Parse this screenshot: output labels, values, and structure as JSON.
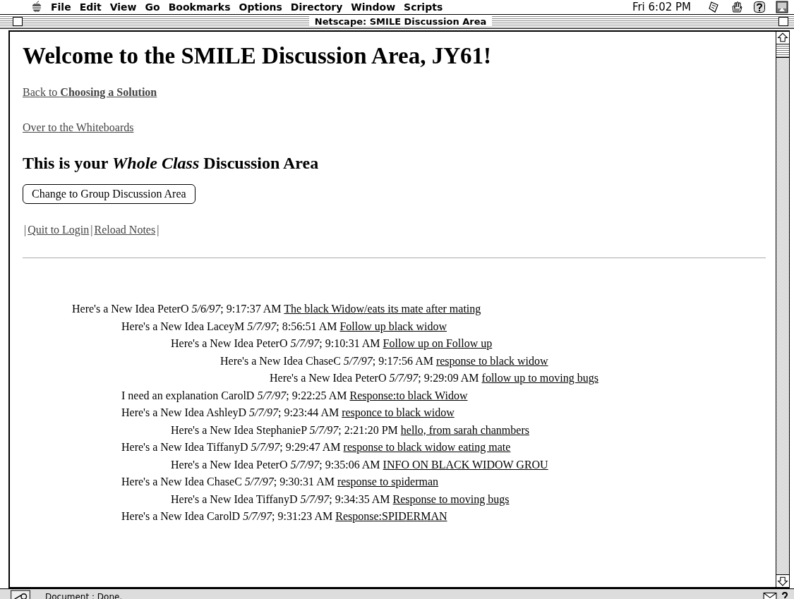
{
  "menu_bar": {
    "items": [
      "File",
      "Edit",
      "View",
      "Go",
      "Bookmarks",
      "Options",
      "Directory",
      "Window",
      "Scripts"
    ],
    "clock": "Fri 6:02 PM"
  },
  "window": {
    "title": "Netscape: SMILE Discussion Area"
  },
  "page": {
    "heading": "Welcome to the SMILE Discussion Area, JY61!",
    "links": [
      "Back to **Choosing a Solution**",
      "Over to the Whiteboards"
    ],
    "subheading": "This is your *Whole Class* Discussion Area",
    "button": "Change to Group Discussion Area",
    "nav": {
      "separator": "|",
      "links": [
        "Quit to Login",
        "Reload Notes"
      ]
    },
    "notes": [
      {
        "meta": "Here's a New Idea PeterO *5/6/97*; 9:17:37 AM",
        "title": "The black Widow/eats its mate after mating",
        "children": [
          {
            "meta": "Here's a New Idea LaceyM *5/7/97*; 8:56:51 AM",
            "title": "Follow up black widow",
            "children": [
              {
                "meta": "Here's a New Idea PeterO *5/7/97*; 9:10:31 AM",
                "title": "Follow up on Follow up",
                "children": [
                  {
                    "meta": "Here's a New Idea ChaseC *5/7/97*; 9:17:56 AM",
                    "title": "response to black widow",
                    "children": [
                      {
                        "meta": "Here's a New Idea PeterO *5/7/97*; 9:29:09 AM",
                        "title": "follow up to moving bugs"
                      }
                    ]
                  }
                ]
              }
            ]
          },
          {
            "meta": "I need an explanation CarolD *5/7/97*; 9:22:25 AM",
            "title": "Response:to black Widow"
          },
          {
            "meta": "Here's a New Idea AshleyD *5/7/97*; 9:23:44 AM",
            "title": "responce to black widow",
            "children": [
              {
                "meta": "Here's a New Idea StephanieP *5/7/97*; 2:21:20 PM",
                "title": "hello, from sarah chanmbers"
              }
            ]
          },
          {
            "meta": "Here's a New Idea TiffanyD *5/7/97*; 9:29:47 AM",
            "title": "response to black widow eating mate",
            "children": [
              {
                "meta": "Here's a New Idea PeterO *5/7/97*; 9:35:06 AM",
                "title": "INFO ON BLACK WIDOW GROU"
              }
            ]
          },
          {
            "meta": "Here's a New Idea ChaseC *5/7/97*; 9:30:31 AM",
            "title": "response to spiderman",
            "children": [
              {
                "meta": "Here's a New Idea TiffanyD *5/7/97*; 9:34:35 AM",
                "title": "Response to moving bugs"
              }
            ]
          },
          {
            "meta": "Here's a New Idea CarolD *5/7/97*; 9:31:23 AM",
            "title": "Response:SPIDERMAN"
          }
        ]
      }
    ]
  },
  "status_bar": {
    "text": "Document : Done."
  }
}
